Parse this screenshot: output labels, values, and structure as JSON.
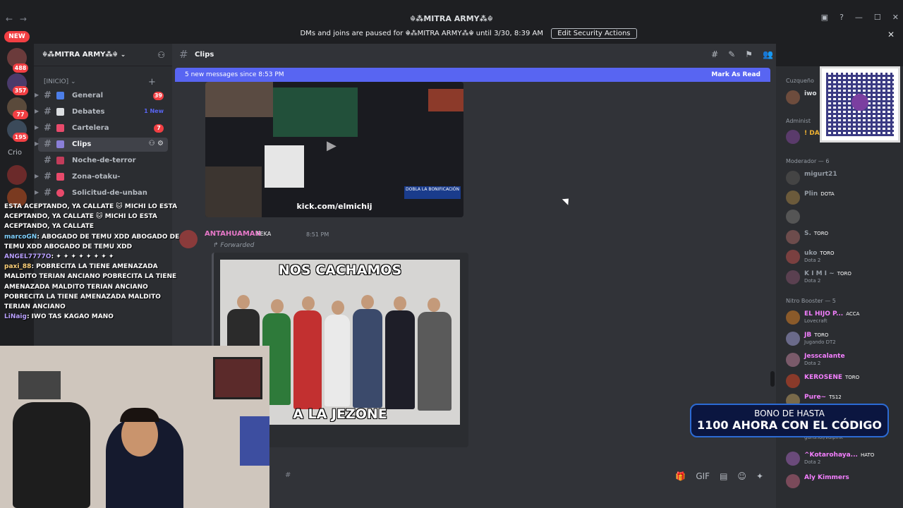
{
  "window": {
    "title": "☬⁂MITRA ARMY⁂☬",
    "back": "←",
    "forward": "→",
    "controls": [
      "▣",
      "?",
      "—",
      "☐",
      "✕"
    ]
  },
  "banner": {
    "text": "DMs and joins are paused for ☬⁂MITRA ARMY⁂☬ until 3/30, 8:39 AM",
    "button": "Edit Security Actions",
    "close": "✕"
  },
  "rail": {
    "new_badge": "NEW",
    "badges": [
      "488",
      "357",
      "77",
      "195"
    ],
    "crio": "Crio"
  },
  "server": {
    "name": "☬⁂MITRA ARMY⁂☬",
    "chevron": "⌄",
    "category": "[INICIO]",
    "category_add": "+",
    "channels": [
      {
        "name": "General",
        "badge": "39",
        "color": "#4c7ee8"
      },
      {
        "name": "Debates",
        "badge": "1 New",
        "color": "#dbdee1"
      },
      {
        "name": "Cartelera",
        "badge": "7",
        "color": "#e84a6b"
      },
      {
        "name": "Clips",
        "badge": "",
        "color": "#8a7fd8"
      },
      {
        "name": "Noche-de-terror",
        "badge": "",
        "color": "#c23c5a"
      },
      {
        "name": "Zona-otaku-",
        "badge": "",
        "color": "#e84a6b"
      },
      {
        "name": "Solicitud-de-unban",
        "badge": "",
        "color": "#e84a6b"
      }
    ]
  },
  "chat": {
    "channel": "Clips",
    "tools": [
      "#",
      "✎",
      "⚑",
      "👥"
    ],
    "new_messages": "5 new messages since 8:53 PM",
    "mark_read": "Mark As Read",
    "stream_url": "kick.com/elmichij",
    "stream_promo": "DOBLA LA BONIFICACIÓN",
    "author": "ANTAHUAMAN",
    "author_tag": "FEKA",
    "time": "8:51 PM",
    "forwarded": "Forwarded",
    "meme_top": "NOS CACHAMOS",
    "meme_bottom": "A LA JEZONE",
    "composer_icons": [
      "🎁",
      "GIF",
      "▤",
      "☺",
      "✦"
    ]
  },
  "members": {
    "sections": [
      "Cuzqueño",
      "Administ",
      "Moderador — 6",
      "Nitro Booster — 5"
    ],
    "list": [
      {
        "name": "iwo",
        "tag": "",
        "sub": ""
      },
      {
        "name": "! DA",
        "tag": "",
        "sub": ""
      },
      {
        "name": "migurt21",
        "tag": "",
        "sub": ""
      },
      {
        "name": "Plin",
        "tag": "DOTA",
        "sub": ""
      },
      {
        "name": "S.",
        "tag": "TORO",
        "sub": ""
      },
      {
        "name": "uko",
        "tag": "TORO",
        "sub": "Dota 2"
      },
      {
        "name": "K I M I ~",
        "tag": "TORO",
        "sub": "Dota 2"
      },
      {
        "name": "EL HIJO P...",
        "tag": "ACCA",
        "sub": "Lovecraft"
      },
      {
        "name": "JB",
        "tag": "TORO",
        "sub": "Jugando DT2"
      },
      {
        "name": "Jesscalante",
        "tag": "",
        "sub": "Dota 2"
      },
      {
        "name": "KEROSENE",
        "tag": "TORO",
        "sub": ""
      },
      {
        "name": "Pure~",
        "tag": "TS12",
        "sub": ""
      },
      {
        "name": "",
        "tag": "",
        "sub": "guns.lol/valplnk"
      },
      {
        "name": "^Kotarohaya...",
        "tag": "HATO",
        "sub": "Dota 2"
      },
      {
        "name": "Aly Kimmers",
        "tag": "",
        "sub": ""
      }
    ]
  },
  "bono": {
    "line1": "BONO DE HASTA",
    "line2": "1100 AHORA CON EL CÓDIGO"
  },
  "overlay_chat": [
    {
      "who": "",
      "text": "ESTA ACEPTANDO, YA CALLATE 🐱 MICHI LO ESTA ACEPTANDO, YA CALLATE 🐱 MICHI LO ESTA ACEPTANDO, YA CALLATE"
    },
    {
      "who": "marcoGN",
      "text": ": ABOGADO DE TEMU XDD ABOGADO DE TEMU XDD ABOGADO DE TEMU XDD"
    },
    {
      "who": "ANGEL7777O",
      "text": ": ✦ ✦ ✦ ✦ ✦ ✦ ✦ ✦"
    },
    {
      "who": "paxi_88",
      "text": ": POBRECITA LA TIENE AMENAZADA MALDITO TERIAN ANCIANO POBRECITA LA TIENE AMENAZADA MALDITO TERIAN ANCIANO POBRECITA LA TIENE AMENAZADA MALDITO TERIAN ANCIANO"
    },
    {
      "who": "LiNaig",
      "text": ": IWO TAS KAGAO MANO"
    }
  ]
}
